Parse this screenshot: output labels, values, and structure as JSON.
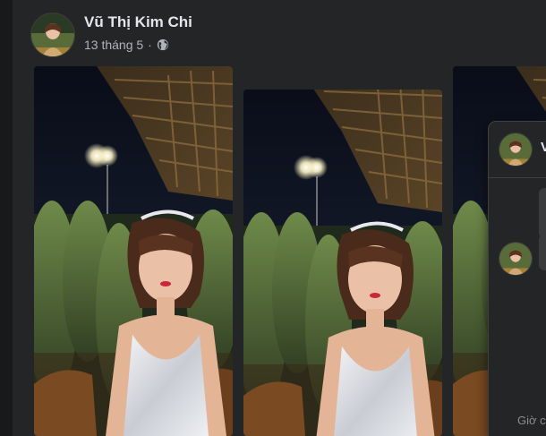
{
  "post": {
    "author": "Vũ Thị Kim Chi",
    "date": "13 tháng 5",
    "separator": "·",
    "privacy_icon": "globe-icon"
  },
  "popup": {
    "name_partial": "V",
    "footer_partial": "Giờ c"
  },
  "colors": {
    "background": "#18191a",
    "card": "#242526",
    "primary_text": "#e4e6eb",
    "secondary_text": "#b0b3b8"
  }
}
